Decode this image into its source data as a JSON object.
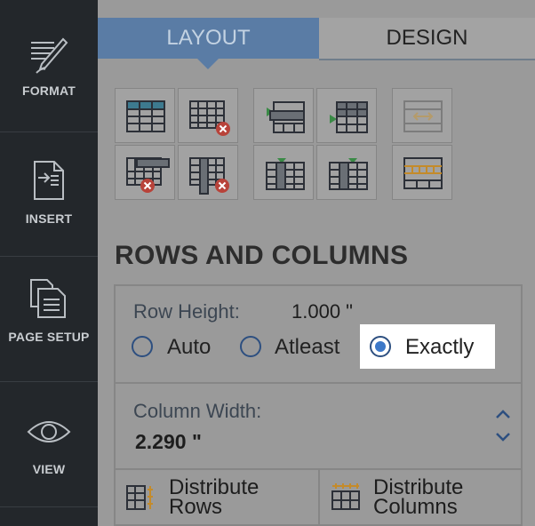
{
  "sidebar": {
    "items": [
      {
        "label": "FORMAT",
        "icon": "pen-icon"
      },
      {
        "label": "INSERT",
        "icon": "insert-document-icon"
      },
      {
        "label": "PAGE SETUP",
        "icon": "page-setup-icon"
      },
      {
        "label": "VIEW",
        "icon": "eye-icon"
      }
    ]
  },
  "tabs": {
    "layout": "LAYOUT",
    "design": "DESIGN",
    "active": "LAYOUT"
  },
  "toolbar": {
    "buttons": [
      "insert-table-icon",
      "delete-table-icon",
      "delete-row-icon",
      "delete-column-icon",
      "insert-row-above-icon",
      "insert-row-below-icon",
      "insert-column-left-icon",
      "insert-column-right-icon",
      "merge-cells-icon",
      "split-cells-icon"
    ]
  },
  "rows_columns": {
    "title": "ROWS AND COLUMNS",
    "row_height_label": "Row Height:",
    "row_height_value": "1.000 \"",
    "options": [
      "Auto",
      "Atleast",
      "Exactly"
    ],
    "selected_option": "Exactly",
    "column_width_label": "Column Width:",
    "column_width_value": "2.290 \"",
    "distribute_rows": [
      "Distribute",
      "Rows"
    ],
    "distribute_columns": [
      "Distribute",
      "Columns"
    ]
  },
  "colors": {
    "sidebar_bg": "#23272b",
    "active_tab": "#5a7ca5",
    "radio_accent": "#3c78c8",
    "delete_badge": "#b8433a"
  }
}
